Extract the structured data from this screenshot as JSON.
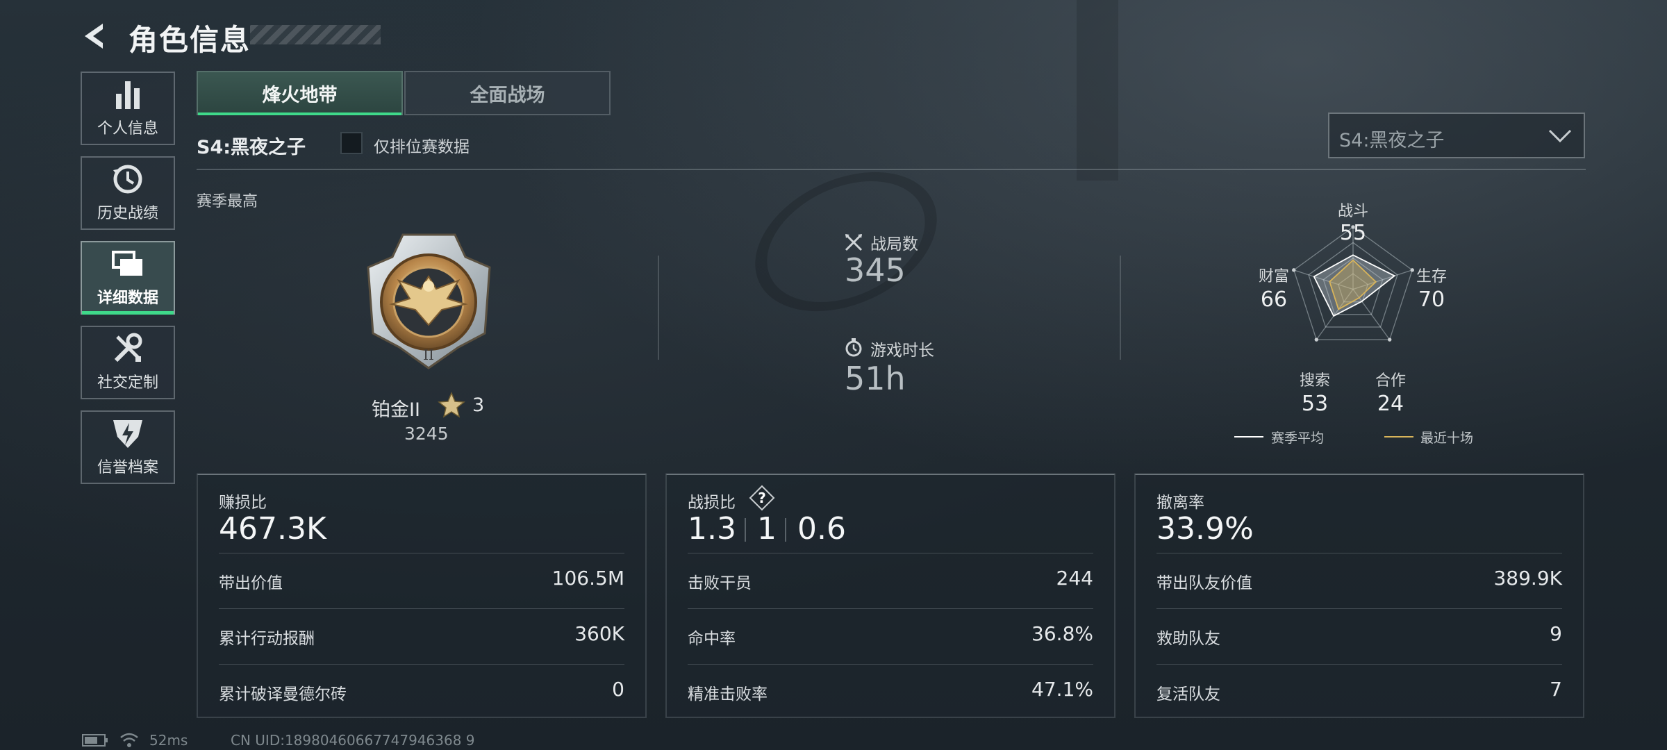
{
  "header": {
    "title": "角色信息"
  },
  "sidebar": {
    "items": [
      {
        "label": "个人信息",
        "icon": "bar-chart-icon"
      },
      {
        "label": "历史战绩",
        "icon": "history-clock-icon"
      },
      {
        "label": "详细数据",
        "icon": "folders-icon",
        "active": true
      },
      {
        "label": "社交定制",
        "icon": "wrench-screwdriver-icon"
      },
      {
        "label": "信誉档案",
        "icon": "shield-bolt-icon"
      }
    ]
  },
  "tabs": [
    {
      "label": "烽火地带",
      "active": true
    },
    {
      "label": "全面战场",
      "active": false
    }
  ],
  "filter": {
    "season_label": "S4:黑夜之子",
    "ranked_only_label": "仅排位赛数据",
    "ranked_only_checked": false,
    "season_select_value": "S4:黑夜之子"
  },
  "season_best": {
    "label": "赛季最高",
    "rank_name": "铂金II",
    "stars": "3",
    "score": "3245"
  },
  "summary": {
    "games_label": "战局数",
    "games_value": "345",
    "time_label": "游戏时长",
    "time_value": "51h"
  },
  "radar": {
    "axes": [
      {
        "label": "战斗",
        "value": "55"
      },
      {
        "label": "生存",
        "value": "70"
      },
      {
        "label": "合作",
        "value": "24"
      },
      {
        "label": "搜索",
        "value": "53"
      },
      {
        "label": "财富",
        "value": "66"
      }
    ],
    "legend": [
      {
        "label": "赛季平均",
        "color": "#ffffff"
      },
      {
        "label": "最近十场",
        "color": "#d8b45a"
      }
    ]
  },
  "cards": [
    {
      "header_label": "赚损比",
      "header_value": "467.3K",
      "rows": [
        {
          "label": "带出价值",
          "value": "106.5M"
        },
        {
          "label": "累计行动报酬",
          "value": "360K"
        },
        {
          "label": "累计破译曼德尔砖",
          "value": "0"
        }
      ]
    },
    {
      "header_label": "战损比",
      "header_values": [
        "1.3",
        "1",
        "0.6"
      ],
      "rows": [
        {
          "label": "击败干员",
          "value": "244"
        },
        {
          "label": "命中率",
          "value": "36.8%"
        },
        {
          "label": "精准击败率",
          "value": "47.1%"
        }
      ]
    },
    {
      "header_label": "撤离率",
      "header_value": "33.9%",
      "rows": [
        {
          "label": "带出队友价值",
          "value": "389.9K"
        },
        {
          "label": "救助队友",
          "value": "9"
        },
        {
          "label": "复活队友",
          "value": "7"
        }
      ]
    }
  ],
  "footer": {
    "ping": "52ms",
    "uid": "CN UID:18980460667747946368 9"
  }
}
